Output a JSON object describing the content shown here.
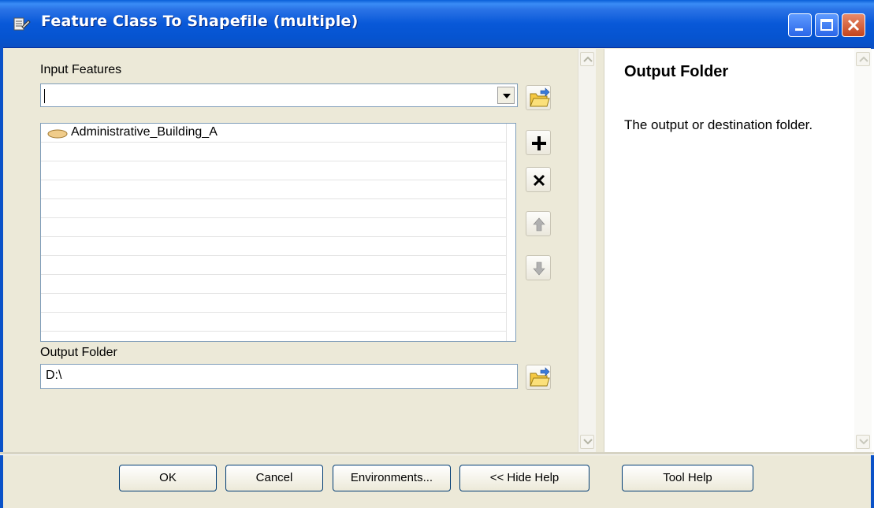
{
  "window": {
    "title": "Feature Class To Shapefile (multiple)"
  },
  "input_features": {
    "label": "Input Features",
    "combo_value": "",
    "items": [
      "Administrative_Building_A"
    ]
  },
  "output_folder": {
    "label": "Output Folder",
    "value": "D:\\"
  },
  "help": {
    "title": "Output Folder",
    "text": "The output or destination folder."
  },
  "buttons": {
    "ok": "OK",
    "cancel": "Cancel",
    "environments": "Environments...",
    "hide_help": "<< Hide Help",
    "tool_help": "Tool Help"
  },
  "icons": {
    "window": "tool-icon",
    "browse": "open-folder-icon",
    "add": "plus-icon",
    "remove": "x-icon",
    "up": "arrow-up-icon",
    "down": "arrow-down-icon",
    "layer": "polygon-layer-icon"
  }
}
